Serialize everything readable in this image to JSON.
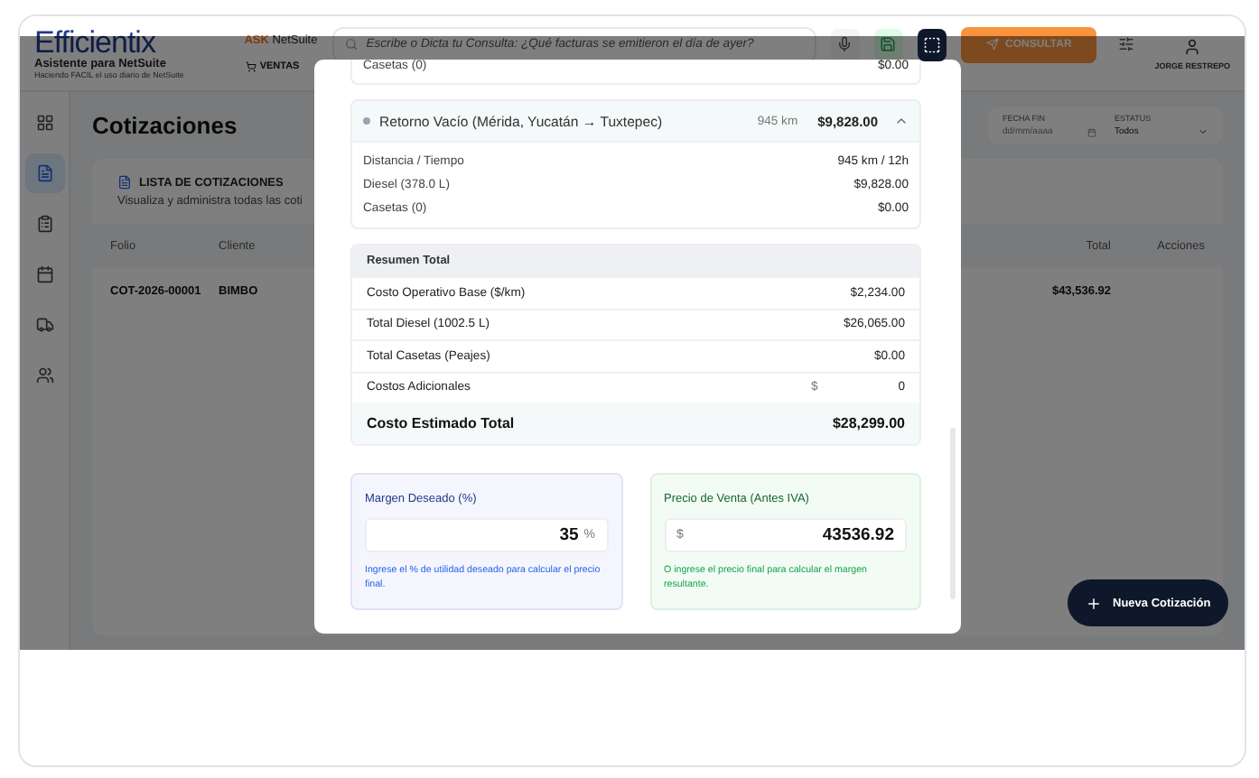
{
  "header": {
    "logo": "Efficientix",
    "subtitle": "Asistente para NetSuite",
    "tagline": "Haciendo FACIL el uso diario de NetSuite",
    "ask_strong": "ASK",
    "ask_rest": "NetSuite",
    "menu": "VENTAS",
    "search_placeholder": "Escribe o Dicta tu Consulta: ¿Qué facturas se emitieron el día de ayer?",
    "capture_selected": true,
    "consult_button": "CONSULTAR",
    "user": "JORGE RESTREPO"
  },
  "sidebar": [
    {
      "kind": "grid",
      "selected": false
    },
    {
      "kind": "document",
      "selected": true
    },
    {
      "kind": "clipboard",
      "selected": false
    },
    {
      "kind": "calendar",
      "selected": false
    },
    {
      "kind": "truck",
      "selected": false
    },
    {
      "kind": "users",
      "selected": false
    }
  ],
  "page": {
    "title": "Cotizaciones",
    "filters": [
      {
        "kind": "date",
        "label": "FECHA FIN",
        "placeholder": "dd/mm/aaaa"
      },
      {
        "kind": "select",
        "label": "ESTATUS",
        "value": "Todos"
      }
    ],
    "list": {
      "title": "LISTA DE COTIZACIONES",
      "subtitle": "Visualiza y administra todas las coti",
      "columns": [
        "Folio",
        "Cliente",
        "Total",
        "Acciones"
      ],
      "rows": [
        {
          "folio": "COT-2026-00001",
          "client": "BIMBO",
          "total": "$43,536.92"
        }
      ]
    }
  },
  "fab": "Nueva Cotización",
  "modal": {
    "prev_row": {
      "label": "Casetas (0)",
      "value": "$0.00"
    },
    "route": {
      "title": "Retorno Vacío (Mérida, Yucatán → Tuxtepec)",
      "distance": "945 km",
      "cost": "$9,828.00",
      "expanded": true,
      "rows": [
        {
          "label": "Distancia / Tiempo",
          "value": "945 km / 12h"
        },
        {
          "label": "Diesel (378.0 L)",
          "value": "$9,828.00"
        },
        {
          "label": "Casetas (0)",
          "value": "$0.00"
        }
      ]
    },
    "summary": {
      "title": "Resumen Total",
      "rows": [
        {
          "kind": "static",
          "label": "Costo Operativo Base ($/km)",
          "value": "$2,234.00"
        },
        {
          "kind": "static",
          "label": "Total Diesel (1002.5 L)",
          "value": "$26,065.00"
        },
        {
          "kind": "static",
          "label": "Total Casetas (Peajes)",
          "value": "$0.00"
        },
        {
          "kind": "input",
          "label": "Costos Adicionales",
          "prefix": "$",
          "value": "0"
        }
      ],
      "total": {
        "label": "Costo Estimado Total",
        "value": "$28,299.00"
      }
    },
    "margin": {
      "label": "Margen Deseado (%)",
      "value": "35",
      "unit": "%",
      "hint": "Ingrese el % de utilidad deseado para calcular el precio final."
    },
    "price": {
      "label": "Precio de Venta (Antes IVA)",
      "prefix": "$",
      "value": "43536.92",
      "hint": "O ingrese el precio final para calcular el margen resultante."
    }
  }
}
